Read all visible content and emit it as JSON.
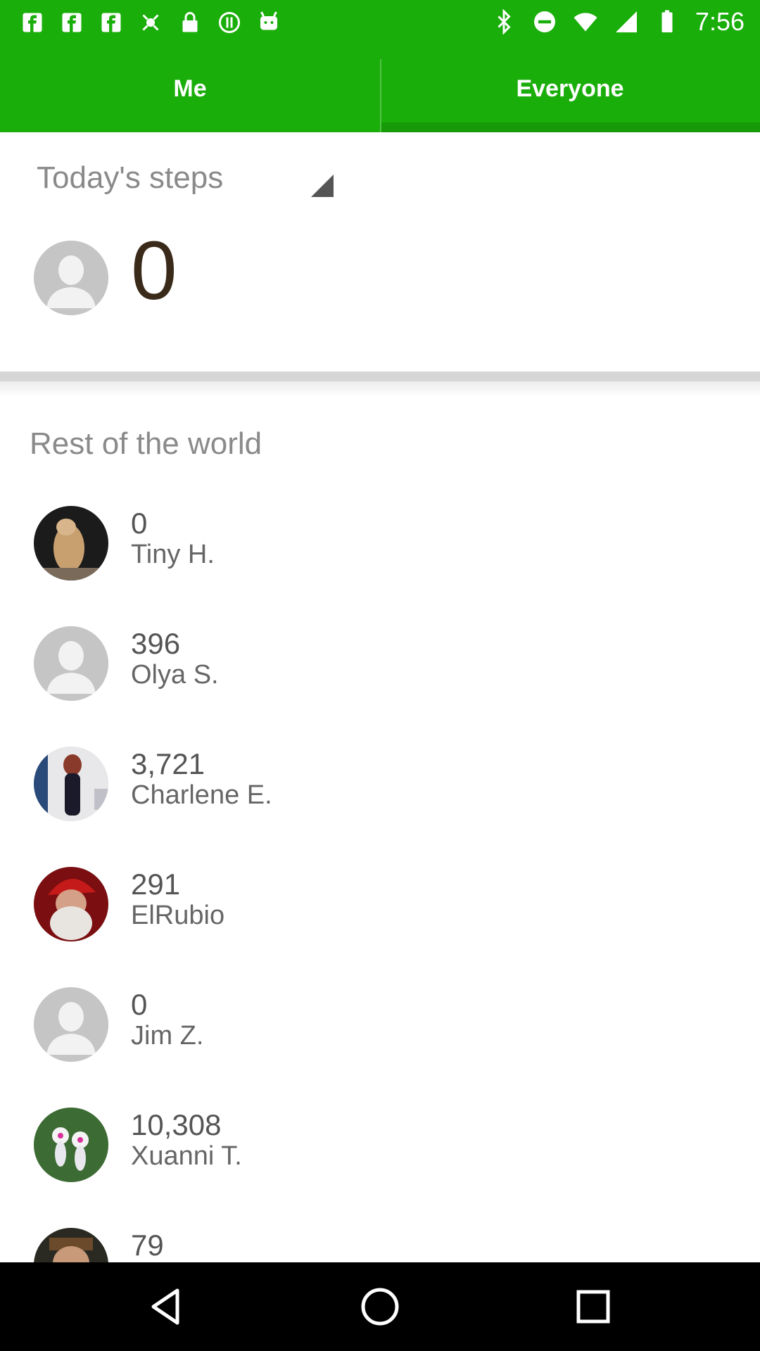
{
  "status_bar": {
    "time": "7:56",
    "left_icons": [
      "fb-icon",
      "fb-icon",
      "fb-icon",
      "fake-gps-icon",
      "lock-icon",
      "circle-info-icon",
      "android-icon"
    ],
    "right_icons": [
      "bluetooth-icon",
      "do-not-disturb-icon",
      "wifi-icon",
      "signal-icon",
      "battery-icon"
    ]
  },
  "tabs": {
    "me_label": "Me",
    "everyone_label": "Everyone",
    "selected": "Everyone"
  },
  "today": {
    "title": "Today's steps",
    "my_steps": "0"
  },
  "world": {
    "title": "Rest of the world",
    "items": [
      {
        "steps": "0",
        "name": "Tiny H.",
        "avatar": "photo-dog"
      },
      {
        "steps": "396",
        "name": "Olya S.",
        "avatar": "default"
      },
      {
        "steps": "3,721",
        "name": "Charlene E.",
        "avatar": "photo-woman"
      },
      {
        "steps": "291",
        "name": "ElRubio",
        "avatar": "photo-santa"
      },
      {
        "steps": "0",
        "name": "Jim Z.",
        "avatar": "default"
      },
      {
        "steps": "10,308",
        "name": "Xuanni T.",
        "avatar": "photo-flowers"
      },
      {
        "steps": "79",
        "name": "",
        "avatar": "photo-man"
      }
    ]
  },
  "colors": {
    "brand_green": "#1aae0a",
    "tab_indicator": "#169a08",
    "nav_bar": "#000000"
  }
}
